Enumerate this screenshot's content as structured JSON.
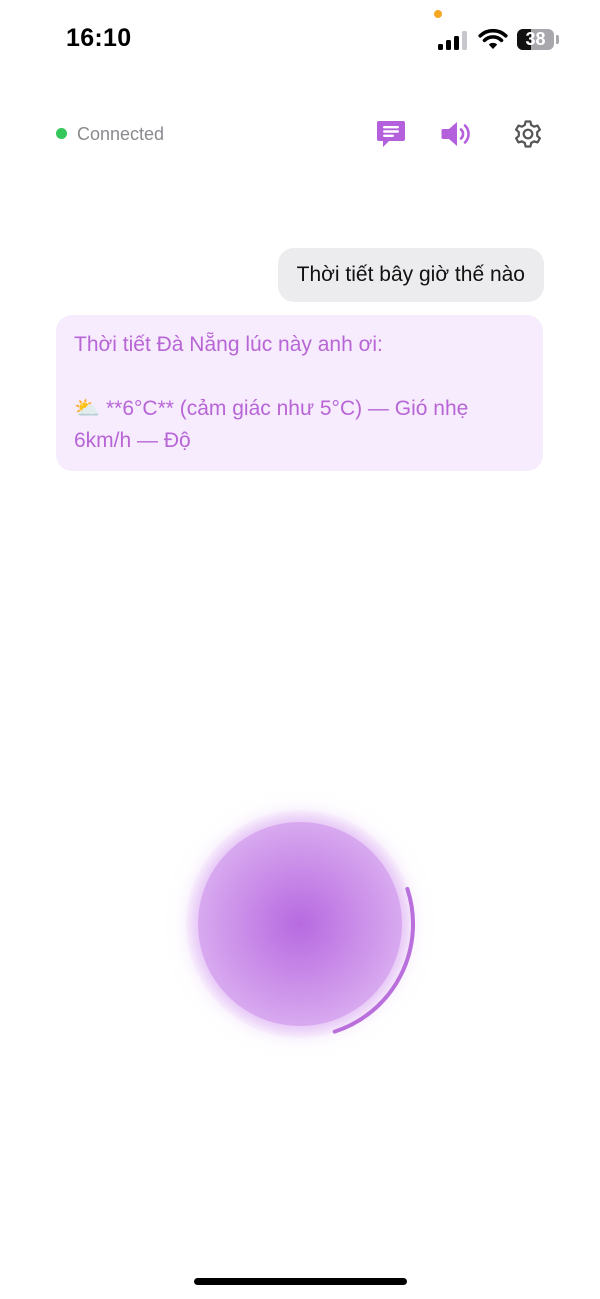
{
  "status_bar": {
    "time": "16:10",
    "battery_percent": "38",
    "battery_level": 0.38,
    "signal_bars_active": 3,
    "signal_bars_total": 4,
    "privacy_dot_color": "#f5a623"
  },
  "header": {
    "connection_label": "Connected",
    "connection_color": "#34c759",
    "icons": [
      "chat-icon",
      "speaker-icon",
      "gear-icon"
    ],
    "accent_color": "#b45fdc"
  },
  "messages": [
    {
      "role": "user",
      "text": "Thời tiết bây giờ thế nào",
      "bg": "#ececee"
    },
    {
      "role": "assistant",
      "line1": "Thời tiết Đà Nẵng lúc này anh ơi:",
      "emoji": "⛅",
      "line2": " **6°C** (cảm giác như 5°C) — Gió nhẹ 6km/h — Độ",
      "bg": "#f6ecfd",
      "color": "#b865d6"
    }
  ],
  "orb": {
    "color": "#b76ae0",
    "arc_color": "#b96fdc"
  }
}
